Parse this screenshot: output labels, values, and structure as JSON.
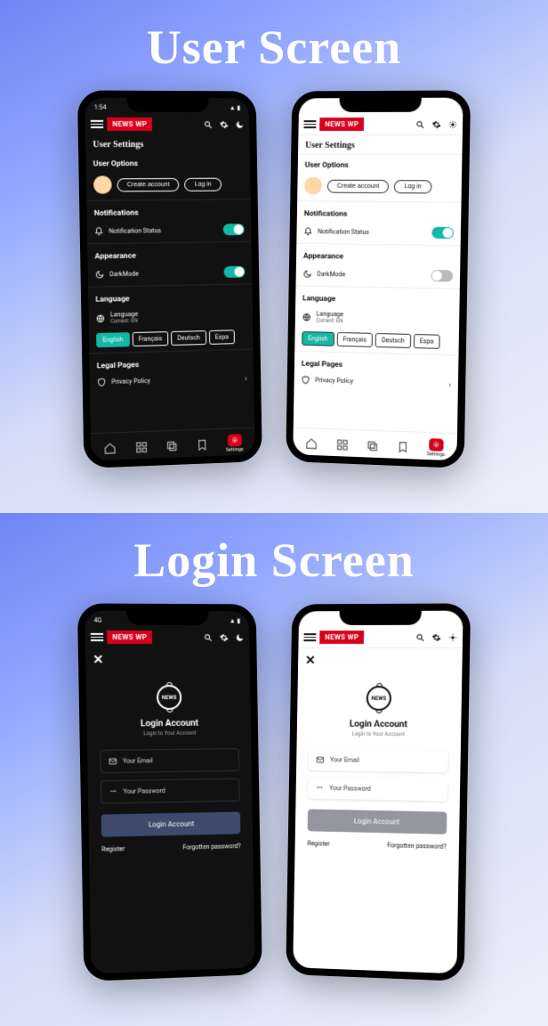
{
  "headings": {
    "section1": "User Screen",
    "section2": "Login Screen"
  },
  "brand": "NEWS WP",
  "status": {
    "time": "1:54",
    "signal": "4G"
  },
  "settings": {
    "page_title": "User Settings",
    "user_options": {
      "header": "User Options",
      "create_account": "Create account",
      "log_in": "Log in"
    },
    "notifications": {
      "header": "Notifications",
      "status_label": "Notification Status",
      "on": true
    },
    "appearance": {
      "header": "Appearance",
      "darkmode_label": "DarkMode",
      "dark_on": true,
      "light_on": false
    },
    "language": {
      "header": "Language",
      "label": "Language",
      "current": "Current: EN",
      "options": [
        "English",
        "Français",
        "Deutsch",
        "Espa"
      ]
    },
    "legal": {
      "header": "Legal Pages",
      "privacy": "Privacy Policy"
    }
  },
  "bottomnav": {
    "active_label": "Settings"
  },
  "login": {
    "title": "Login Account",
    "subtitle": "Login to Your Account",
    "email_ph": "Your Email",
    "password_ph": "Your Password",
    "submit": "Login Account",
    "register": "Register",
    "forgot": "Forgotten password?"
  },
  "logo_text": "NEWS"
}
